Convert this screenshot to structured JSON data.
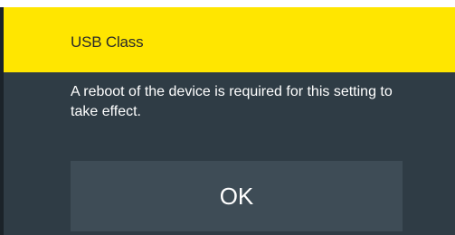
{
  "dialog": {
    "title": "USB Class",
    "message": "A reboot of the device is required for this setting to take effect.",
    "ok_label": "OK"
  },
  "colors": {
    "title_bar": "#ffe600",
    "dialog_bg": "#2f3c45",
    "button_bg": "#3e4c56"
  }
}
